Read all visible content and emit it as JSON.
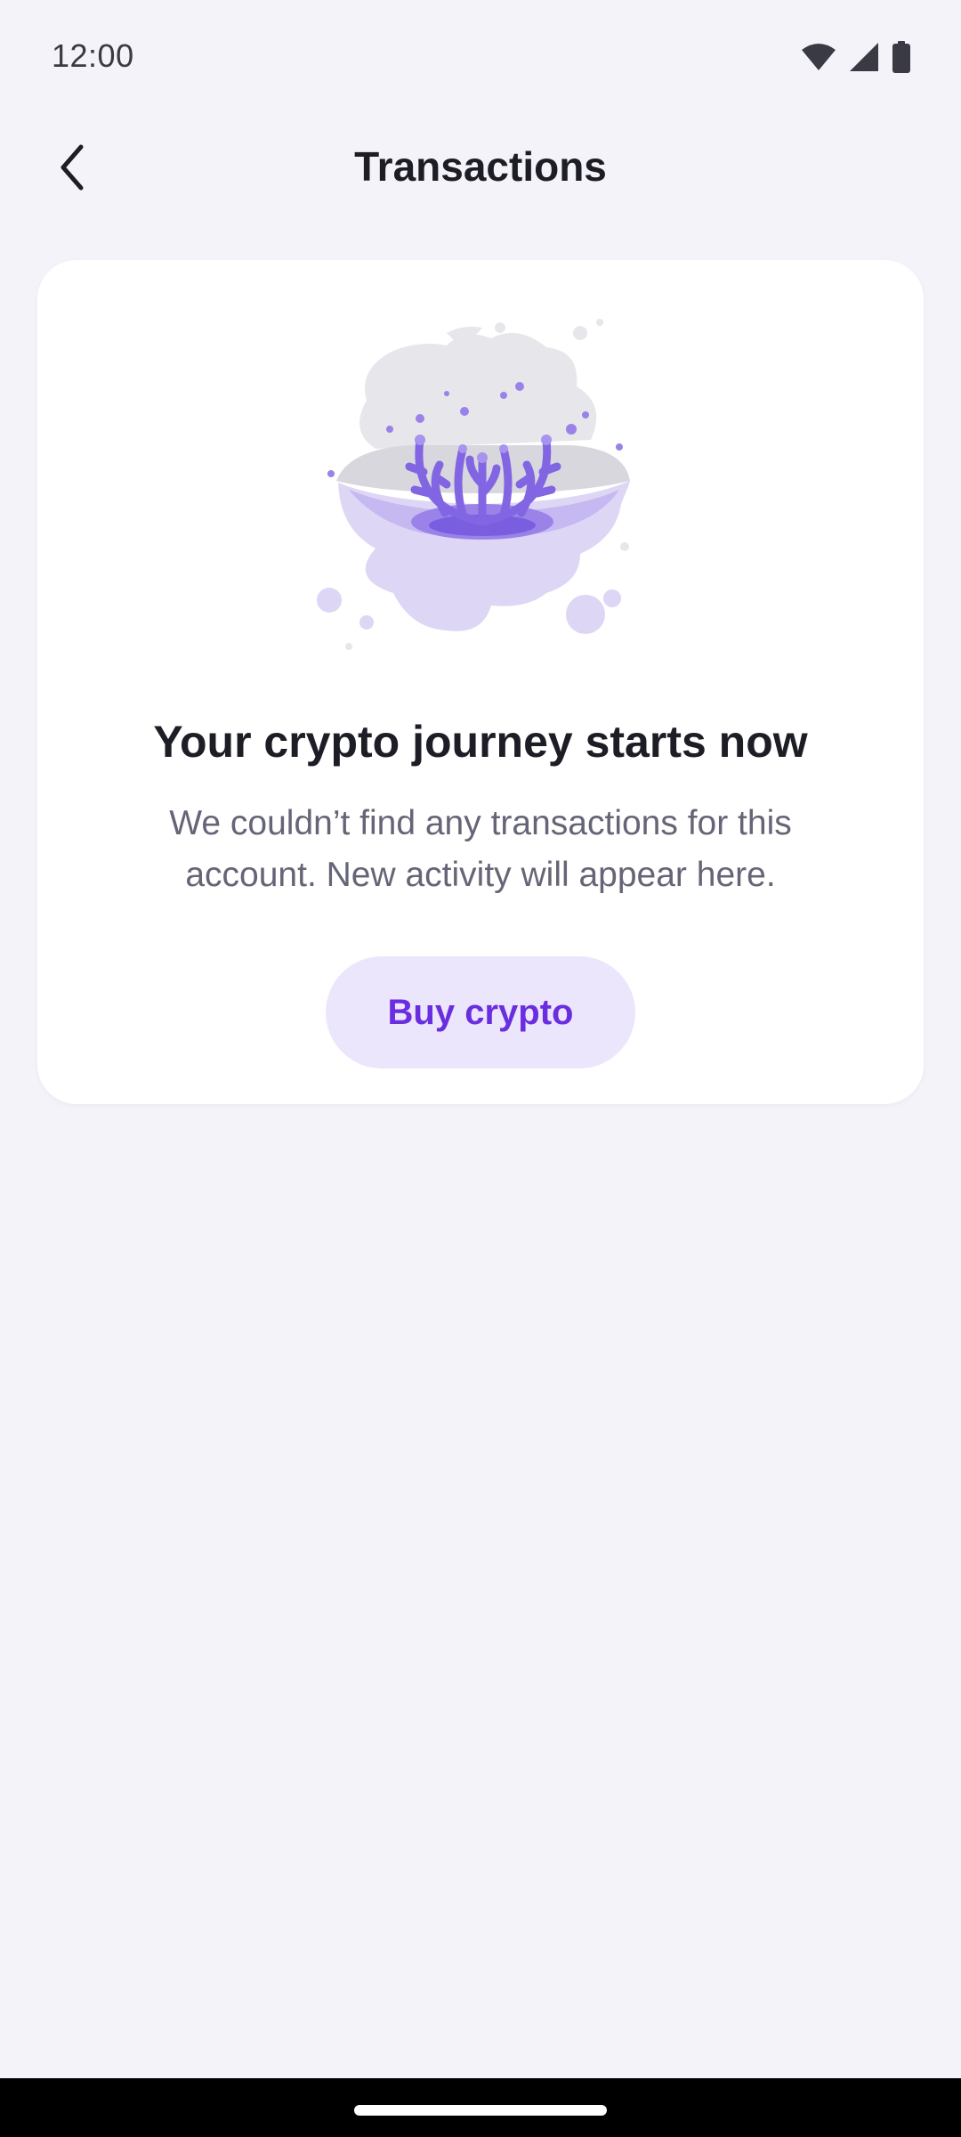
{
  "status_bar": {
    "time": "12:00",
    "icons": [
      "wifi-icon",
      "cellular-signal-icon",
      "battery-icon"
    ]
  },
  "app_bar": {
    "title": "Transactions",
    "back_icon": "chevron-left-icon"
  },
  "empty_state": {
    "illustration": "coral-underwater-illustration",
    "title": "Your crypto journey starts now",
    "body": "We couldn’t find any transactions for this account. New activity will appear here.",
    "button_label": "Buy crypto"
  },
  "colors": {
    "background": "#f4f3f9",
    "card": "#ffffff",
    "accent": "#6a2ee0",
    "button_bg": "#ece6fd",
    "title_text": "#1d1d26",
    "body_text": "#656577"
  }
}
